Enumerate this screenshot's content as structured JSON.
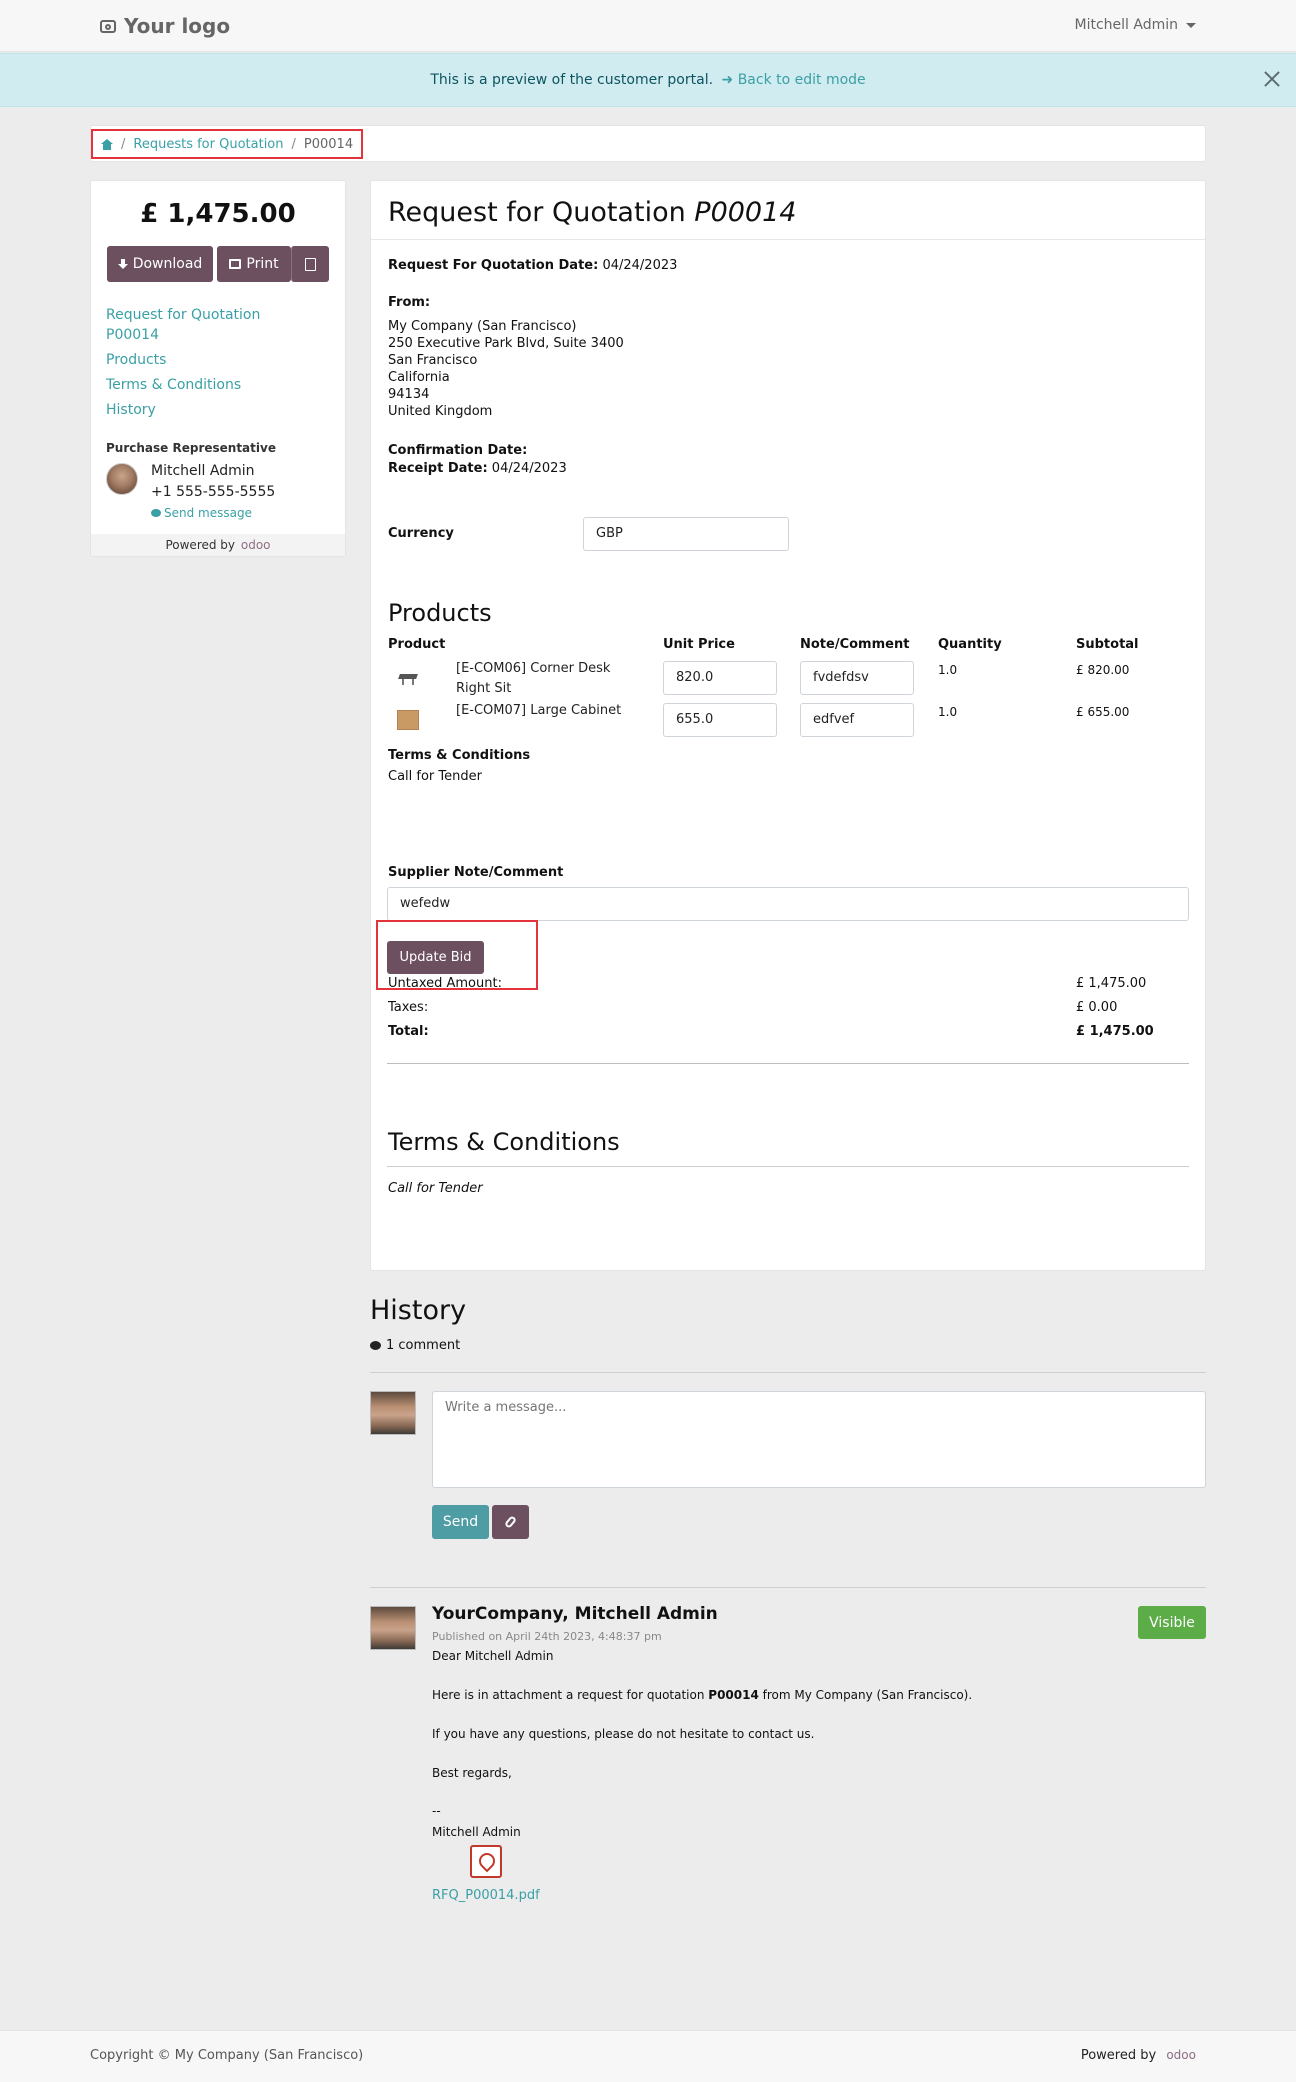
{
  "navbar": {
    "logo": "Your logo",
    "user": "Mitchell Admin"
  },
  "preview": {
    "text": "This is a preview of the customer portal.",
    "link": "Back to edit mode"
  },
  "breadcrumb": {
    "item1": "Requests for Quotation",
    "item2": "P00014"
  },
  "sidebar": {
    "total": "£ 1,475.00",
    "download": "Download",
    "print": "Print",
    "nav": {
      "rfq_line1": "Request for Quotation",
      "rfq_line2": "P00014",
      "products": "Products",
      "terms": "Terms & Conditions",
      "history": "History"
    },
    "rep_label": "Purchase Representative",
    "rep_name": "Mitchell Admin",
    "rep_phone": "+1 555-555-5555",
    "send_message": "Send message",
    "powered": "Powered by",
    "odoo": "odoo"
  },
  "main": {
    "title": "Request for Quotation",
    "title_ref": "P00014",
    "rfq_date_label": "Request For Quotation Date:",
    "rfq_date": "04/24/2023",
    "from_label": "From:",
    "address": [
      "My Company (San Francisco)",
      "250 Executive Park Blvd, Suite 3400",
      "San Francisco",
      "California",
      "94134",
      "United Kingdom"
    ],
    "confirmation_label": "Confirmation Date:",
    "receipt_label": "Receipt Date:",
    "receipt_date": "04/24/2023",
    "currency_label": "Currency",
    "currency_value": "GBP",
    "products_heading": "Products",
    "columns": {
      "product": "Product",
      "unit_price": "Unit Price",
      "note": "Note/Comment",
      "quantity": "Quantity",
      "subtotal": "Subtotal"
    },
    "lines": [
      {
        "name_l1": "[E-COM06] Corner Desk",
        "name_l2": "Right Sit",
        "price": "820.0",
        "note": "fvdefdsv",
        "qty": "1.0",
        "subtotal": "£ 820.00"
      },
      {
        "name_l1": "[E-COM07] Large Cabinet",
        "name_l2": "",
        "price": "655.0",
        "note": "edfvef",
        "qty": "1.0",
        "subtotal": "£ 655.00"
      }
    ],
    "terms_label": "Terms & Conditions",
    "terms_value": "Call for Tender",
    "supplier_label": "Supplier Note/Comment",
    "supplier_value": "wefedw",
    "update_bid": "Update Bid",
    "untaxed_label": "Untaxed Amount:",
    "untaxed": "£ 1,475.00",
    "taxes_label": "Taxes:",
    "taxes": "£ 0.00",
    "total_label": "Total:",
    "total": "£ 1,475.00",
    "terms_heading": "Terms & Conditions",
    "terms_text": "Call for Tender"
  },
  "history": {
    "heading": "History",
    "count": "1 comment",
    "placeholder": "Write a message...",
    "send": "Send",
    "author": "YourCompany, Mitchell Admin",
    "published": "Published on April 24th 2023, 4:48:37 pm",
    "visible": "Visible",
    "greeting": "Dear Mitchell Admin",
    "body_pre": "Here is in attachment a request for quotation ",
    "body_ref": "P00014",
    "body_post": " from My Company (San Francisco).",
    "questions": "If you have any questions, please do not hesitate to contact us.",
    "regards": "Best regards,",
    "dashes": "--",
    "signature": "Mitchell Admin",
    "attachment": "RFQ_P00014.pdf"
  },
  "footer": {
    "copyright": "Copyright © My Company (San Francisco)",
    "powered": "Powered by",
    "odoo": "odoo"
  }
}
